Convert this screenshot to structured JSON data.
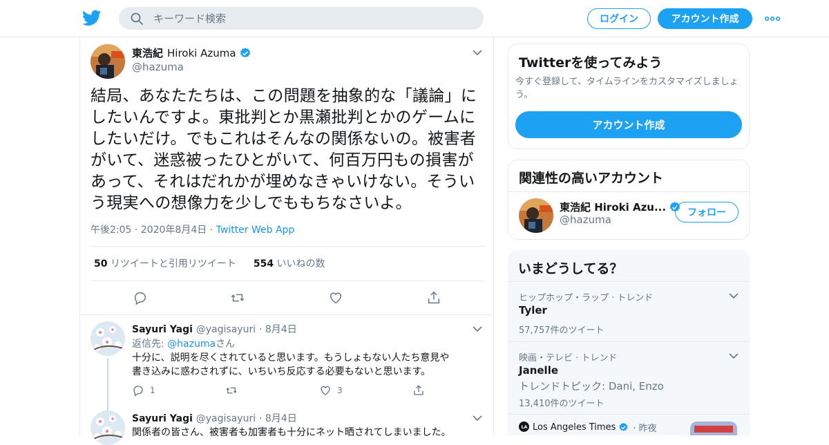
{
  "header": {
    "search_placeholder": "キーワード検索",
    "login_label": "ログイン",
    "signup_label": "アカウント作成"
  },
  "tweet": {
    "display_name": "東浩紀",
    "display_name_latin": "Hiroki Azuma",
    "handle": "@hazuma",
    "text": "結局、あなたたちは、この問題を抽象的な「議論」にしたいんですよ。東批判とか黒瀬批判とかのゲームにしたいだけ。でもこれはそんなの関係ないの。被害者がいて、迷惑被ったひとがいて、何百万円もの損害があって、それはだれかが埋めなきゃいけない。そういう現実への想像力を少しでももちなさいよ。",
    "time": "午後2:05",
    "date": "2020年8月4日",
    "source": "Twitter Web App",
    "retweets": "50",
    "retweets_label": "リツイートと引用リツイート",
    "likes": "554",
    "likes_label": "いいねの数"
  },
  "replies": [
    {
      "name": "Sayuri Yagi",
      "handle": "@yagisayuri",
      "date": "8月4日",
      "reply_prefix": "返信先: ",
      "reply_to": "@hazuma",
      "reply_suffix": "さん",
      "body_line1": "十分に、説明を尽くされていると思います。もうしょもない人たち意見や",
      "body_line2": "書き込みに惑わされずに、いちいち反応する必要もないと思います。",
      "reply_count": "1",
      "retweet_count": "",
      "like_count": "3"
    },
    {
      "name": "Sayuri Yagi",
      "handle": "@yagisayuri",
      "date": "8月4日",
      "body_line1": "関係者の皆さん、被害者も加害者も十分にネット晒されてしまいました。"
    }
  ],
  "sidebar": {
    "signup_card": {
      "title": "Twitterを使ってみよう",
      "subtitle_line1": "今すぐ登録して、タイムラインをカスタマイズしましょ",
      "subtitle_line2": "う。",
      "button": "アカウント作成"
    },
    "related": {
      "title": "関連性の高いアカウント",
      "name": "東浩紀 Hiroki Azu...",
      "handle": "@hazuma",
      "follow_label": "フォロー"
    },
    "trends": {
      "title": "いまどうしてる？",
      "items": [
        {
          "category": "ヒップホップ・ラップ · トレンド",
          "name": "Tyler",
          "count": "57,757件のツイート"
        },
        {
          "category": "映画・テレビ · トレンド",
          "name": "Janelle",
          "description": "トレンドトピック: Dani, Enzo",
          "count": "13,410件のツイート"
        }
      ],
      "news": {
        "source": "Los Angeles Times",
        "time": "· 昨夜"
      }
    }
  },
  "colors": {
    "brand_blue": "#1da1f2",
    "link_blue": "#1b95e0",
    "secondary_text": "#657786",
    "border": "#e6ecf0"
  },
  "icons": [
    "twitter-logo-icon",
    "search-icon",
    "more-dots-icon",
    "verified-icon",
    "chevron-down-icon",
    "reply-icon",
    "retweet-icon",
    "like-icon",
    "share-icon"
  ]
}
